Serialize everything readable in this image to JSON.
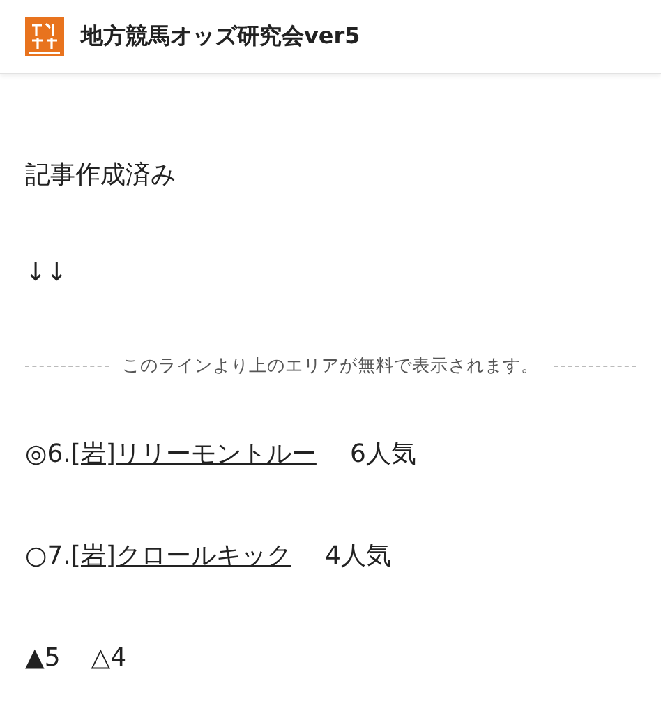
{
  "header": {
    "title": "地方競馬オッズ研究会ver5"
  },
  "paragraphs": [
    "記事作成済み",
    "↓↓"
  ],
  "divider": {
    "text": "このラインより上のエリアが無料で表示されます。"
  },
  "picks": [
    {
      "mark": "◎6.",
      "horse": "[岩]リリーモントルー",
      "popularity": "6人気"
    },
    {
      "mark": "○7.",
      "horse": "[岩]クロールキック",
      "popularity": "4人気"
    }
  ],
  "others": [
    "▲5",
    "△4"
  ]
}
